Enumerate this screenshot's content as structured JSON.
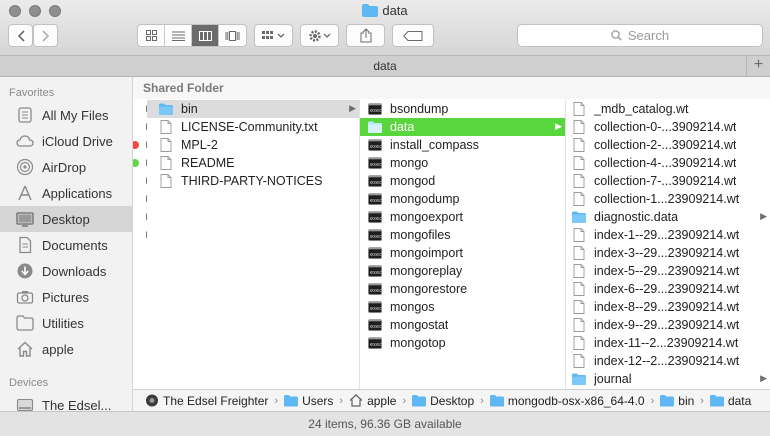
{
  "window": {
    "title": "data"
  },
  "toolbar": {
    "search_placeholder": "Search"
  },
  "tabbar": {
    "tab_title": "data",
    "add_label": "+"
  },
  "sidebar": {
    "favorites_heading": "Favorites",
    "favorites": [
      {
        "label": "All My Files",
        "icon": "all-files-icon"
      },
      {
        "label": "iCloud Drive",
        "icon": "cloud-icon"
      },
      {
        "label": "AirDrop",
        "icon": "airdrop-icon"
      },
      {
        "label": "Applications",
        "icon": "applications-icon"
      },
      {
        "label": "Desktop",
        "icon": "desktop-icon",
        "selected": true
      },
      {
        "label": "Documents",
        "icon": "document-icon"
      },
      {
        "label": "Downloads",
        "icon": "download-icon"
      },
      {
        "label": "Pictures",
        "icon": "camera-icon"
      },
      {
        "label": "Utilities",
        "icon": "folder-icon"
      },
      {
        "label": "apple",
        "icon": "home-icon"
      }
    ],
    "devices_heading": "Devices",
    "devices": [
      {
        "label": "The Edsel...",
        "icon": "disk-icon"
      }
    ]
  },
  "main": {
    "section_heading": "Shared Folder",
    "col1": [
      {
        "label": "bin",
        "type": "folder",
        "highlighted": true
      },
      {
        "label": "LICENSE-Community.txt",
        "type": "doc"
      },
      {
        "label": "MPL-2",
        "type": "doc"
      },
      {
        "label": "README",
        "type": "doc"
      },
      {
        "label": "THIRD-PARTY-NOTICES",
        "type": "doc"
      }
    ],
    "col2": [
      {
        "label": "bsondump",
        "type": "exec"
      },
      {
        "label": "data",
        "type": "folder",
        "selected": true
      },
      {
        "label": "install_compass",
        "type": "exec"
      },
      {
        "label": "mongo",
        "type": "exec"
      },
      {
        "label": "mongod",
        "type": "exec"
      },
      {
        "label": "mongodump",
        "type": "exec"
      },
      {
        "label": "mongoexport",
        "type": "exec"
      },
      {
        "label": "mongofiles",
        "type": "exec"
      },
      {
        "label": "mongoimport",
        "type": "exec"
      },
      {
        "label": "mongoreplay",
        "type": "exec"
      },
      {
        "label": "mongorestore",
        "type": "exec"
      },
      {
        "label": "mongos",
        "type": "exec"
      },
      {
        "label": "mongostat",
        "type": "exec"
      },
      {
        "label": "mongotop",
        "type": "exec"
      }
    ],
    "col3": [
      {
        "label": "_mdb_catalog.wt",
        "type": "doc"
      },
      {
        "label": "collection-0-...3909214.wt",
        "type": "doc"
      },
      {
        "label": "collection-2-...3909214.wt",
        "type": "doc"
      },
      {
        "label": "collection-4-...3909214.wt",
        "type": "doc"
      },
      {
        "label": "collection-7-...3909214.wt",
        "type": "doc"
      },
      {
        "label": "collection-1...23909214.wt",
        "type": "doc"
      },
      {
        "label": "diagnostic.data",
        "type": "folder"
      },
      {
        "label": "index-1--29...23909214.wt",
        "type": "doc"
      },
      {
        "label": "index-3--29...23909214.wt",
        "type": "doc"
      },
      {
        "label": "index-5--29...23909214.wt",
        "type": "doc"
      },
      {
        "label": "index-6--29...23909214.wt",
        "type": "doc"
      },
      {
        "label": "index-8--29...23909214.wt",
        "type": "doc"
      },
      {
        "label": "index-9--29...23909214.wt",
        "type": "doc"
      },
      {
        "label": "index-11--2...23909214.wt",
        "type": "doc"
      },
      {
        "label": "index-12--2...23909214.wt",
        "type": "doc"
      },
      {
        "label": "journal",
        "type": "folder"
      }
    ]
  },
  "pathbar": [
    {
      "label": "The Edsel Freighter",
      "icon": "disk-icon"
    },
    {
      "label": "Users",
      "icon": "folder-icon"
    },
    {
      "label": "apple",
      "icon": "home-icon"
    },
    {
      "label": "Desktop",
      "icon": "folder-icon"
    },
    {
      "label": "mongodb-osx-x86_64-4.0",
      "icon": "folder-icon"
    },
    {
      "label": "bin",
      "icon": "folder-icon"
    },
    {
      "label": "data",
      "icon": "folder-icon"
    }
  ],
  "status": {
    "text": "24 items, 96.36 GB available"
  },
  "colors": {
    "selection_green": "#5ad63d",
    "folder_blue": "#5fb8f4",
    "tag_red": "#f04a43",
    "tag_green": "#67d34a"
  }
}
